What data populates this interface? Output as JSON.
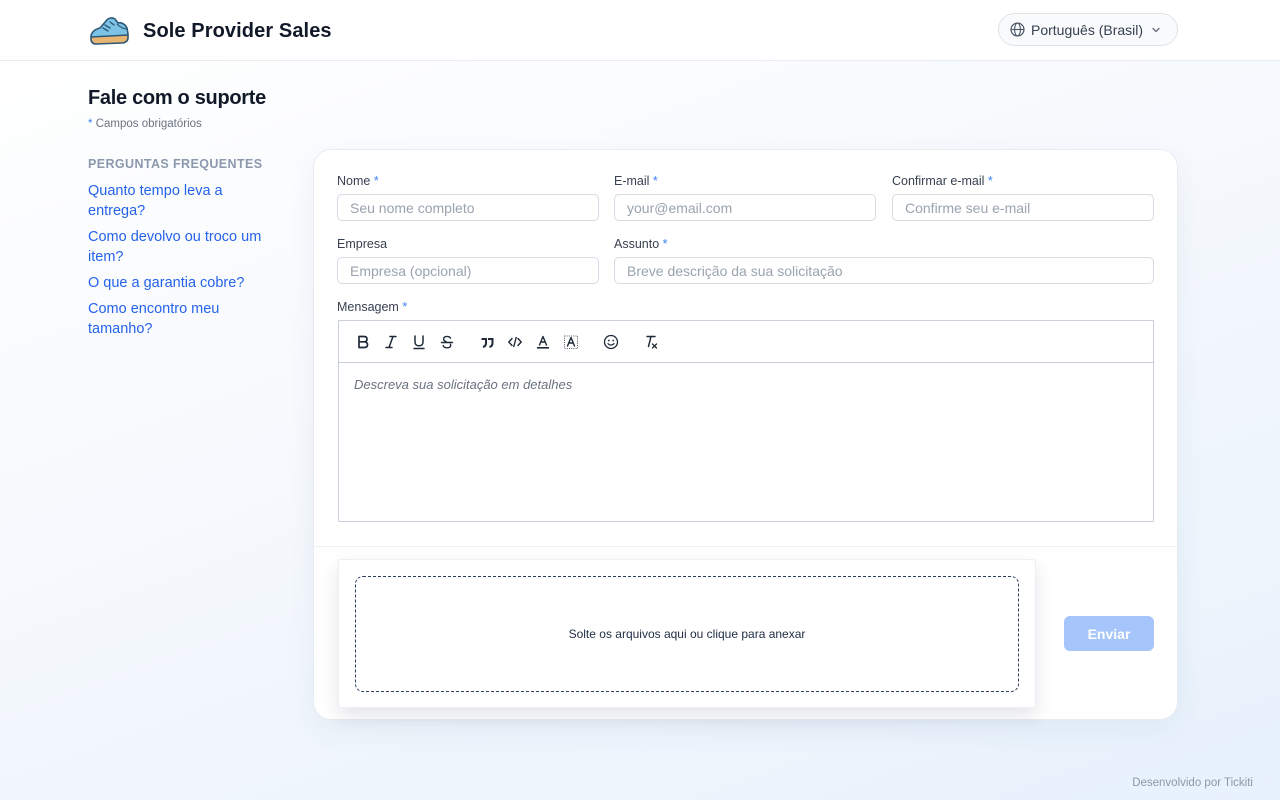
{
  "header": {
    "brand_name": "Sole Provider Sales",
    "language_label": "Português (Brasil)",
    "icons": {
      "logo": "sneaker-logo",
      "language": "globe-icon",
      "dropdown": "chevron-down-icon"
    }
  },
  "sidebar": {
    "title": "Fale com o suporte",
    "required_mark": "*",
    "required_note": "Campos obrigatórios",
    "faq_heading": "PERGUNTAS FREQUENTES",
    "faq_items": [
      {
        "label": "Quanto tempo leva a entrega?"
      },
      {
        "label": "Como devolvo ou troco um item?"
      },
      {
        "label": "O que a garantia cobre?"
      },
      {
        "label": "Como encontro meu tamanho?"
      }
    ]
  },
  "form": {
    "required_mark": "*",
    "name": {
      "label": "Nome",
      "placeholder": "Seu nome completo",
      "value": ""
    },
    "email": {
      "label": "E-mail",
      "placeholder": "your@email.com",
      "value": ""
    },
    "confirm_email": {
      "label": "Confirmar e-mail",
      "placeholder": "Confirme seu e-mail",
      "value": ""
    },
    "company": {
      "label": "Empresa",
      "placeholder": "Empresa (opcional)",
      "value": ""
    },
    "subject": {
      "label": "Assunto",
      "placeholder": "Breve descrição da sua solicitação",
      "value": ""
    },
    "message": {
      "label": "Mensagem",
      "placeholder": "Descreva sua solicitação em detalhes",
      "toolbar": [
        "bold-icon",
        "italic-icon",
        "underline-icon",
        "strikethrough-icon",
        "quote-icon",
        "code-icon",
        "text-color-icon",
        "highlight-icon",
        "emoji-icon",
        "clear-format-icon"
      ]
    },
    "dropzone_text": "Solte os arquivos aqui ou clique para anexar",
    "submit_label": "Enviar"
  },
  "footer": {
    "credit": "Desenvolvido por Tickiti"
  },
  "colors": {
    "accent": "#2563eb",
    "submit_disabled": "#a6c5fb",
    "required_mark": "#3b82f6"
  }
}
